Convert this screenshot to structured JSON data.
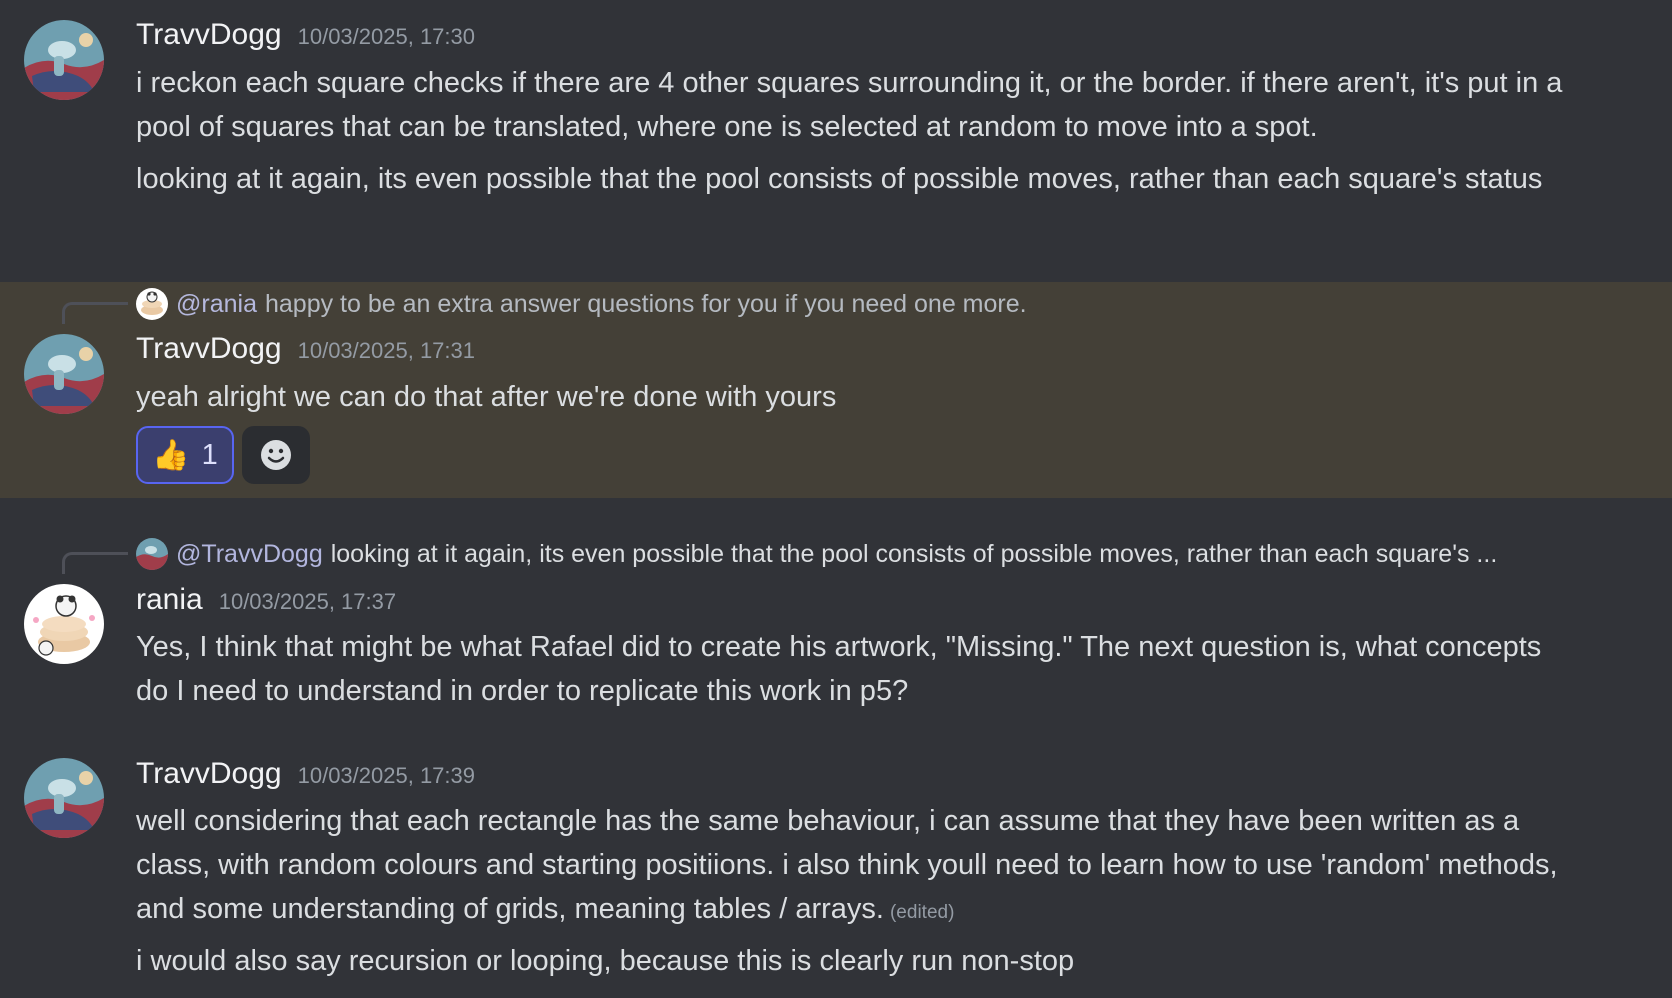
{
  "messages": [
    {
      "author": "TravvDogg",
      "timestamp": "10/03/2025, 17:30",
      "lines": [
        "i reckon each square checks if there are 4 other squares surrounding it, or the border. if there aren't, it's put in a pool of squares that can be translated, where one is selected at random to move into a spot.",
        "looking at it again, its even possible that the pool consists of possible moves, rather than each square's status"
      ]
    },
    {
      "reply": {
        "mention": "@rania",
        "preview": "happy to be an extra answer questions for you if you need one more."
      },
      "author": "TravvDogg",
      "timestamp": "10/03/2025, 17:31",
      "lines": [
        "yeah alright we can do that after we're done with yours"
      ],
      "reactions": [
        {
          "emoji": "👍",
          "count": "1"
        }
      ]
    },
    {
      "reply": {
        "mention": "@TravvDogg",
        "preview": "looking at it again, its even possible that the pool consists of possible moves, rather than each square's ..."
      },
      "author": "rania",
      "timestamp": "10/03/2025, 17:37",
      "lines": [
        "Yes, I think that might be what Rafael did to create his artwork, \"Missing.\" The next question is, what concepts do I need to understand in order to replicate this work in p5?"
      ]
    },
    {
      "author": "TravvDogg",
      "timestamp": "10/03/2025, 17:39",
      "lines": [
        "well considering that each rectangle has the same behaviour, i can assume that they have been written as a class, with random colours and starting positiions. i also think youll need to learn how to use 'random' methods, and some understanding of grids, meaning tables / arrays.",
        "i would also say recursion or looping, because this is clearly run non-stop"
      ],
      "edited_label": "(edited)"
    }
  ],
  "icons": {
    "add_reaction": "smiley-face-icon",
    "travvdogg_avatar": "squidward-avatar",
    "rania_avatar": "panda-pancakes-avatar"
  },
  "colors": {
    "background": "#313338",
    "highlight": "#444037",
    "reaction_active_border": "#5865f2"
  }
}
